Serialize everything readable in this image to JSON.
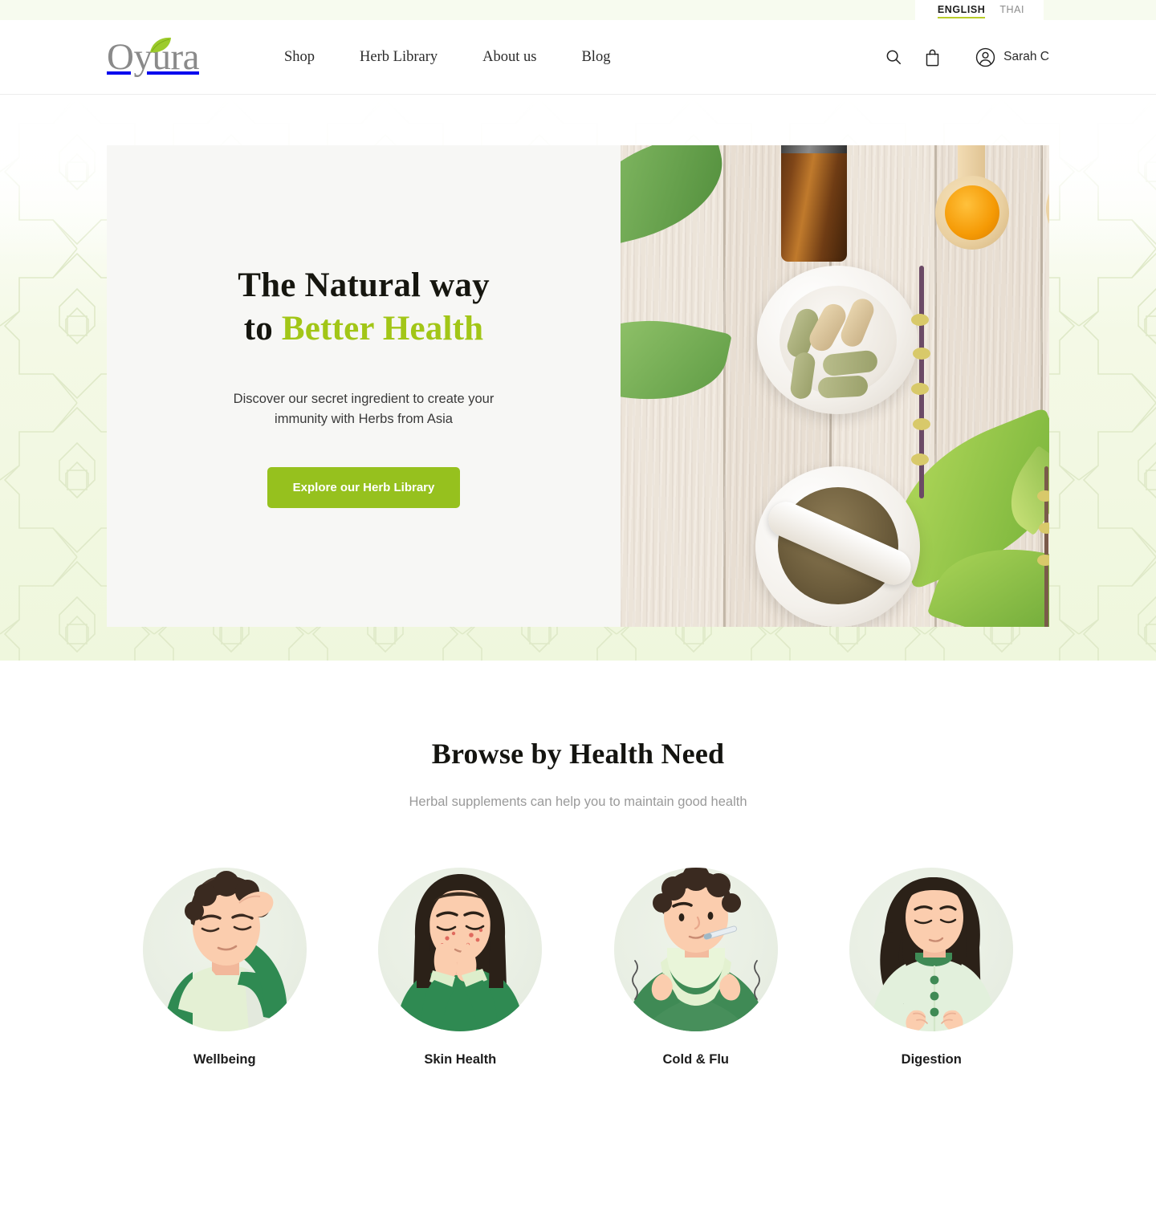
{
  "topbar": {
    "languages": [
      {
        "label": "ENGLISH",
        "active": true
      },
      {
        "label": "THAI",
        "active": false
      }
    ]
  },
  "header": {
    "logo_text": "Oyura",
    "logo_icon": "leaf-icon",
    "nav": [
      {
        "label": "Shop"
      },
      {
        "label": "Herb Library"
      },
      {
        "label": "About us"
      },
      {
        "label": "Blog"
      }
    ],
    "icons": [
      {
        "name": "search-icon"
      },
      {
        "name": "shopping-bag-icon"
      },
      {
        "name": "user-avatar-icon"
      }
    ],
    "account_name": "Sarah C"
  },
  "hero": {
    "title_line1": "The Natural way",
    "title_line2_prefix": "to ",
    "title_line2_accent": "Better Health",
    "subtitle": "Discover our secret ingredient to create your immunity with Herbs from Asia",
    "cta_label": "Explore our Herb Library",
    "image_alt": "Herbal supplements, mortar and pestle, capsules and dried herbs on wooden board"
  },
  "browse": {
    "title": "Browse by Health Need",
    "subtitle": "Herbal supplements can help you to maintain good health",
    "categories": [
      {
        "label": "Wellbeing",
        "illustration": "person-headache-illustration"
      },
      {
        "label": "Skin Health",
        "illustration": "person-acne-illustration"
      },
      {
        "label": "Cold & Flu",
        "illustration": "person-fever-illustration"
      },
      {
        "label": "Digestion",
        "illustration": "person-stomachache-illustration"
      }
    ]
  },
  "colors": {
    "accent_green": "#96c11e",
    "accent_light_green": "#a2c617",
    "underline_green": "#b9cc28",
    "pale_green_bg": "#eff7dd",
    "text_dark": "#16160f",
    "text_muted": "#9a9a9a"
  }
}
